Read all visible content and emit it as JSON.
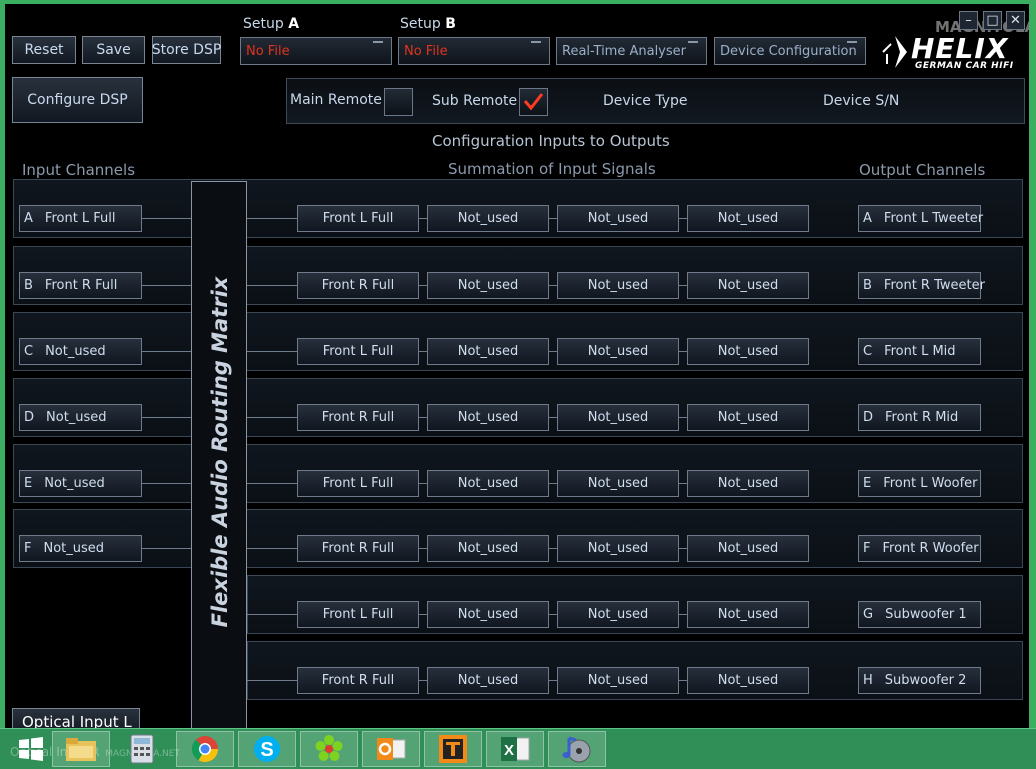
{
  "toolbar": {
    "reset_label": "Reset",
    "save_label": "Save",
    "store_dsp_label": "Store DSP",
    "configure_dsp_label": "Configure DSP"
  },
  "setup_a": {
    "label": "Setup",
    "letter": "A",
    "value": "No File"
  },
  "setup_b": {
    "label": "Setup",
    "letter": "B",
    "value": "No File"
  },
  "menus": {
    "analyser": "Real-Time Analyser",
    "device_config": "Device Configuration"
  },
  "logo": {
    "brand": "HELIX",
    "tagline": "GERMAN CAR HIFI",
    "overlay": "MAGNITOLA"
  },
  "remote": {
    "main_label": "Main Remote",
    "main_checked": false,
    "sub_label": "Sub Remote",
    "sub_checked": true,
    "device_type_label": "Device Type",
    "device_sn_label": "Device S/N"
  },
  "sections": {
    "config_title": "Configuration Inputs to Outputs",
    "inputs_title": "Input Channels",
    "summation_title": "Summation of Input Signals",
    "outputs_title": "Output Channels"
  },
  "matrix_title": "Flexible Audio Routing Matrix",
  "inputs": [
    {
      "letter": "A",
      "name": "Front L Full"
    },
    {
      "letter": "B",
      "name": "Front R Full"
    },
    {
      "letter": "C",
      "name": "Not_used"
    },
    {
      "letter": "D",
      "name": "Not_used"
    },
    {
      "letter": "E",
      "name": "Not_used"
    },
    {
      "letter": "F",
      "name": "Not_used"
    }
  ],
  "summation_rows": [
    [
      "Front L Full",
      "Not_used",
      "Not_used",
      "Not_used"
    ],
    [
      "Front R Full",
      "Not_used",
      "Not_used",
      "Not_used"
    ],
    [
      "Front L Full",
      "Not_used",
      "Not_used",
      "Not_used"
    ],
    [
      "Front R Full",
      "Not_used",
      "Not_used",
      "Not_used"
    ],
    [
      "Front L Full",
      "Not_used",
      "Not_used",
      "Not_used"
    ],
    [
      "Front R Full",
      "Not_used",
      "Not_used",
      "Not_used"
    ],
    [
      "Front L Full",
      "Not_used",
      "Not_used",
      "Not_used"
    ],
    [
      "Front R Full",
      "Not_used",
      "Not_used",
      "Not_used"
    ]
  ],
  "outputs": [
    {
      "letter": "A",
      "name": "Front L Tweeter"
    },
    {
      "letter": "B",
      "name": "Front R Tweeter"
    },
    {
      "letter": "C",
      "name": "Front L Mid"
    },
    {
      "letter": "D",
      "name": "Front R Mid"
    },
    {
      "letter": "E",
      "name": "Front L Woofer"
    },
    {
      "letter": "F",
      "name": "Front R Woofer"
    },
    {
      "letter": "G",
      "name": "Subwoofer 1"
    },
    {
      "letter": "H",
      "name": "Subwoofer 2"
    }
  ],
  "optical_input_label": "Optical Input L",
  "taskbar": {
    "ghost_text": "Optical Input R",
    "ghost_watermark": "MAGNITOLA.NET",
    "apps": [
      {
        "name": "start-icon"
      },
      {
        "name": "file-explorer-icon"
      },
      {
        "name": "calculator-icon"
      },
      {
        "name": "chrome-icon"
      },
      {
        "name": "skype-icon"
      },
      {
        "name": "icq-icon"
      },
      {
        "name": "outlook-icon"
      },
      {
        "name": "t-app-icon"
      },
      {
        "name": "excel-icon"
      },
      {
        "name": "media-app-icon"
      }
    ]
  },
  "colors": {
    "background": "#000000",
    "text": "#c8d8ea",
    "red_text": "#e0341f",
    "check_mark": "#ff3b20",
    "taskbar": "#2f8f57"
  }
}
